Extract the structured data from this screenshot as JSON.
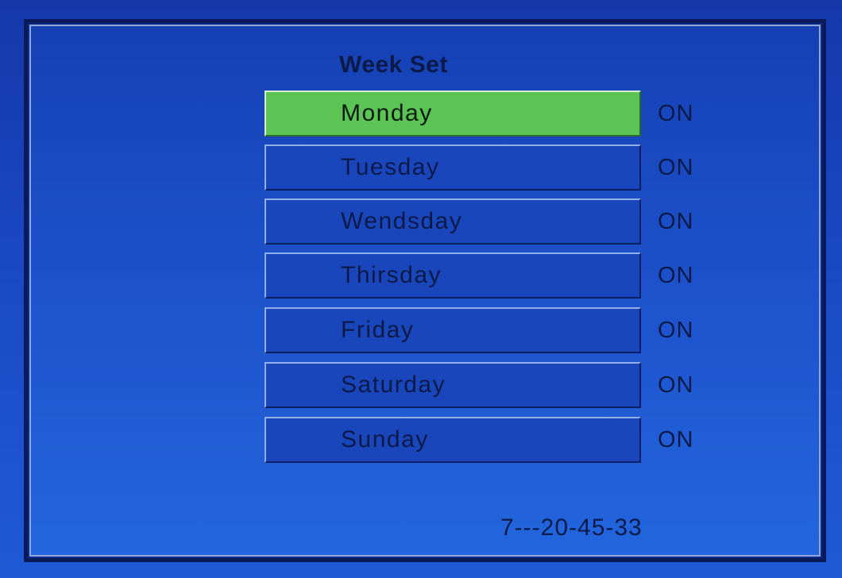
{
  "menu": {
    "title": "Week Set",
    "selected_index": 0,
    "items": [
      {
        "label": "Monday",
        "state": "ON"
      },
      {
        "label": "Tuesday",
        "state": "ON"
      },
      {
        "label": "Wendsday",
        "state": "ON"
      },
      {
        "label": "Thirsday",
        "state": "ON"
      },
      {
        "label": "Friday",
        "state": "ON"
      },
      {
        "label": "Saturday",
        "state": "ON"
      },
      {
        "label": "Sunday",
        "state": "ON"
      }
    ]
  },
  "footer": {
    "code": "7---20-45-33"
  },
  "colors": {
    "background": "#1a48c4",
    "selected": "#5bc455",
    "text": "#0b1a48"
  }
}
